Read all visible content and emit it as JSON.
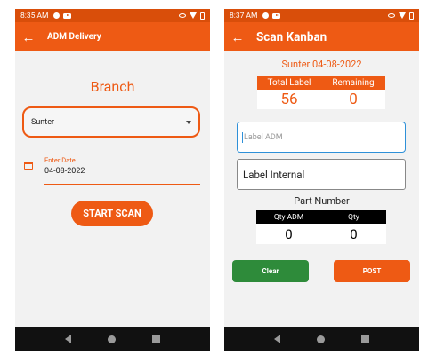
{
  "screen1": {
    "status": {
      "time": "8:35 AM"
    },
    "appbar": {
      "title": "ADM Delivery"
    },
    "branch_title": "Branch",
    "branch_select": {
      "value": "Sunter"
    },
    "date_field": {
      "label": "Enter Date",
      "value": "04-08-2022"
    },
    "start_button": "START SCAN"
  },
  "screen2": {
    "status": {
      "time": "8:37 AM"
    },
    "appbar": {
      "title": "Scan Kanban"
    },
    "header": "Sunter 04-08-2022",
    "counts": {
      "total_label_header": "Total Label",
      "remaining_header": "Remaining",
      "total_label_value": "56",
      "remaining_value": "0"
    },
    "label_adm": {
      "placeholder": "Label ADM"
    },
    "label_internal": {
      "value": "Label Internal"
    },
    "part_number": "Part Number",
    "qty": {
      "adm_header": "Qty ADM",
      "qty_header": "Qty",
      "adm_value": "0",
      "qty_value": "0"
    },
    "clear_button": "Clear",
    "post_button": "POST"
  },
  "colors": {
    "accent": "#ee5a14",
    "status_bar": "#d94e0a",
    "clear_green": "#2e8b3a",
    "focus_blue": "#2e90d8"
  }
}
